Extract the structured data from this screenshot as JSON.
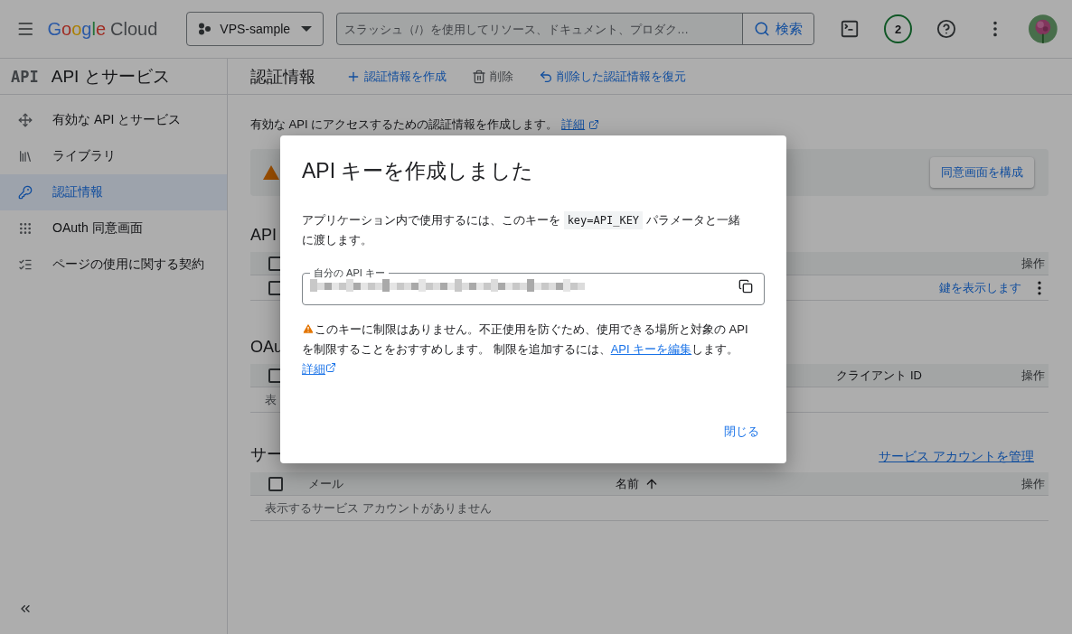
{
  "topbar": {
    "brand": "Google",
    "product": "Cloud",
    "project": "VPS-sample",
    "search": {
      "placeholder": "スラッシュ（/）を使用してリソース、ドキュメント、プロダク…"
    },
    "search_button": "検索",
    "notifications": "2"
  },
  "sidebar": {
    "logo": "API",
    "title": "API とサービス",
    "items": [
      {
        "label": "有効な API とサービス",
        "selected": false
      },
      {
        "label": "ライブラリ",
        "selected": false
      },
      {
        "label": "認証情報",
        "selected": true
      },
      {
        "label": "OAuth 同意画面",
        "selected": false
      },
      {
        "label": "ページの使用に関する契約",
        "selected": false
      }
    ]
  },
  "page": {
    "title": "認証情報",
    "actions": [
      {
        "label": "認証情報を作成",
        "disabled": false
      },
      {
        "label": "削除",
        "disabled": true
      },
      {
        "label": "削除した認証情報を復元",
        "disabled": false
      }
    ]
  },
  "intro": {
    "text": "有効な API にアクセスするための認証情報を作成します。",
    "link": "詳細"
  },
  "banner": {
    "button": "同意画面を構成"
  },
  "api_keys": {
    "heading": "API",
    "header_checked": false,
    "columns": [
      "操作"
    ],
    "rows": [
      {
        "checked": false,
        "action": "鍵を表示します"
      }
    ]
  },
  "oauth": {
    "heading": "OAu",
    "header_checked": false,
    "columns": [
      "クライアント ID",
      "操作"
    ],
    "empty": "表"
  },
  "service_accounts": {
    "heading": "サー",
    "manage_link": "サービス アカウントを管理",
    "header_checked": false,
    "columns": [
      "メール",
      "名前",
      "操作"
    ],
    "empty": "表示するサービス アカウントがありません"
  },
  "dialog": {
    "title": "API キーを作成しました",
    "body_before": "アプリケーション内で使用するには、このキーを",
    "code": "key=API_KEY",
    "body_after": "パラメータと一緒に渡します。",
    "field_label": "自分の API キー",
    "warning": "このキーに制限はありません。不正使用を防ぐため、使用できる場所と対象の API を制限することをおすすめします。 制限を追加するには、",
    "warning_link": "API キーを編集",
    "warning_after": "します。",
    "details_link": "詳細",
    "close": "閉じる"
  }
}
